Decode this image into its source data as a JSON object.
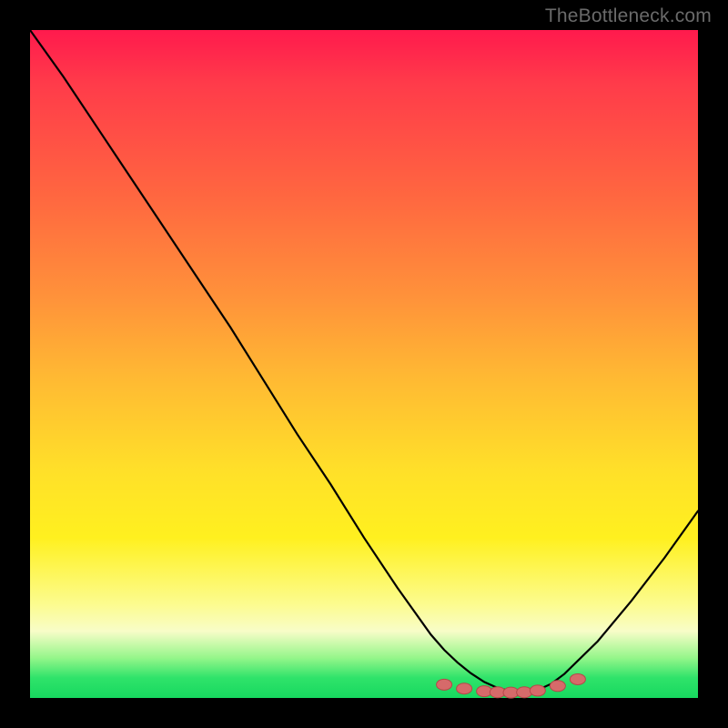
{
  "watermark": "TheBottleneck.com",
  "colors": {
    "frame": "#000000",
    "gradient_top": "#ff1a4d",
    "gradient_bottom": "#17d85f",
    "curve_stroke": "#000000",
    "point_fill": "#d66a6a",
    "point_stroke": "#b44848"
  },
  "chart_data": {
    "type": "line",
    "title": "",
    "xlabel": "",
    "ylabel": "",
    "xlim": [
      0,
      100
    ],
    "ylim": [
      0,
      100
    ],
    "grid": false,
    "legend": false,
    "curve_x": [
      0,
      5,
      10,
      15,
      20,
      25,
      30,
      35,
      40,
      45,
      50,
      55,
      60,
      62,
      64,
      66,
      68,
      70,
      72,
      74,
      76,
      78,
      80,
      85,
      90,
      95,
      100
    ],
    "curve_y": [
      100,
      93,
      85.5,
      78,
      70.5,
      63,
      55.5,
      47.5,
      39.5,
      32,
      24,
      16.5,
      9.5,
      7.2,
      5.3,
      3.7,
      2.4,
      1.5,
      1.0,
      0.8,
      1.2,
      2.1,
      3.6,
      8.5,
      14.5,
      21,
      28
    ],
    "points": [
      {
        "x": 62,
        "y": 2.0
      },
      {
        "x": 65,
        "y": 1.4
      },
      {
        "x": 68,
        "y": 1.0
      },
      {
        "x": 70,
        "y": 0.85
      },
      {
        "x": 72,
        "y": 0.8
      },
      {
        "x": 74,
        "y": 0.85
      },
      {
        "x": 76,
        "y": 1.1
      },
      {
        "x": 79,
        "y": 1.8
      },
      {
        "x": 82,
        "y": 2.8
      }
    ]
  }
}
